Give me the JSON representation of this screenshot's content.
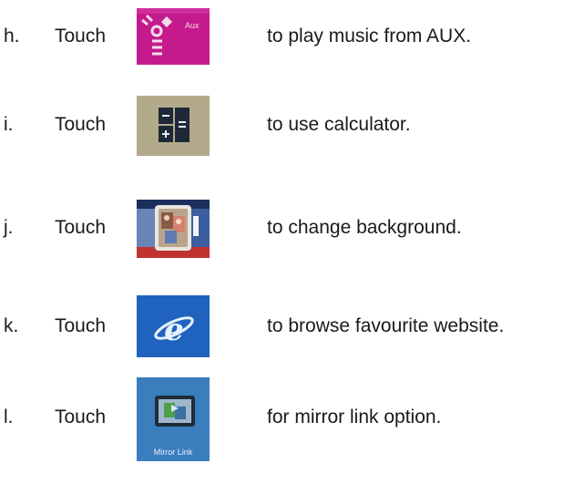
{
  "items": [
    {
      "letter": "h.",
      "touch": "Touch",
      "icon": "aux-icon",
      "icon_label": "Aux",
      "description": "to play music from AUX."
    },
    {
      "letter": "i.",
      "touch": "Touch",
      "icon": "calculator-icon",
      "description": "to use calculator."
    },
    {
      "letter": "j.",
      "touch": "Touch",
      "icon": "photo-frame-icon",
      "description": "to change background."
    },
    {
      "letter": "k.",
      "touch": "Touch",
      "icon": "internet-explorer-icon",
      "description": "to browse favourite website."
    },
    {
      "letter": "l.",
      "touch": "Touch",
      "icon": "mirror-link-icon",
      "icon_label": "Mirror Link",
      "description": "for mirror link option."
    }
  ],
  "colors": {
    "aux_bg": "#c51a8e",
    "calculator_bg": "#b8ae8f",
    "ie_bg": "#1b5fb8",
    "mirror_bg": "#2f73b5"
  }
}
